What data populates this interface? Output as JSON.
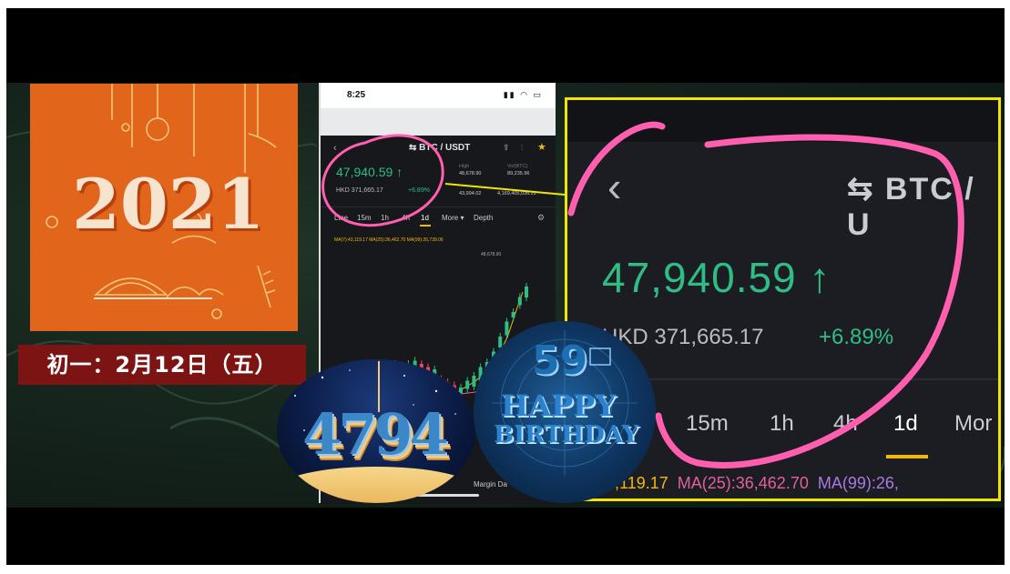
{
  "card": {
    "year": "2021",
    "date_banner": "初一：2月12日（五）",
    "colors": {
      "background": "#e2651c",
      "banner": "#7d1414"
    }
  },
  "phone": {
    "status_time": "8:25",
    "pair": "⇆ BTC / USDT",
    "price": "47,940.59 ↑",
    "hkd": "HKD 371,665.17",
    "change": "+6.89%",
    "stats": {
      "high_label": "High",
      "high": "48,678.90",
      "vol_label": "Vol(BTC)",
      "vol": "89,235.96",
      "low": "43,994.02",
      "vol_usdt": "4,169,405,036.22"
    },
    "timeframes": [
      "Line",
      "15m",
      "1h",
      "4h",
      "1d",
      "More ▾",
      "Depth"
    ],
    "ma_text": "MA(7):43,119.17  MA(25):36,462.70  MA(99):26,739.06",
    "high_marker": "48,678.90",
    "bottom_label": "Margin Da"
  },
  "zoom": {
    "back_icon": "‹",
    "pair": "⇆ BTC / U",
    "price": "47,940.59 ↑",
    "hkd": "HKD 371,665.17",
    "change": "+6.89%",
    "timeframes": [
      "15m",
      "1h",
      "4h",
      "1d",
      "Mor"
    ],
    "ma7": "(7):43,119.17",
    "ma25": "MA(25):36,462.70",
    "ma99": "MA(99):26,",
    "colors": {
      "border": "#f2e600",
      "up": "#2ebd85",
      "underline": "#f0b90b",
      "annotation": "#ff5fae"
    }
  },
  "images": {
    "circle_left_text": "4794",
    "circle_right_number": "59",
    "circle_right_line1": "HAPPY",
    "circle_right_line2": "BIRTHDAY"
  }
}
